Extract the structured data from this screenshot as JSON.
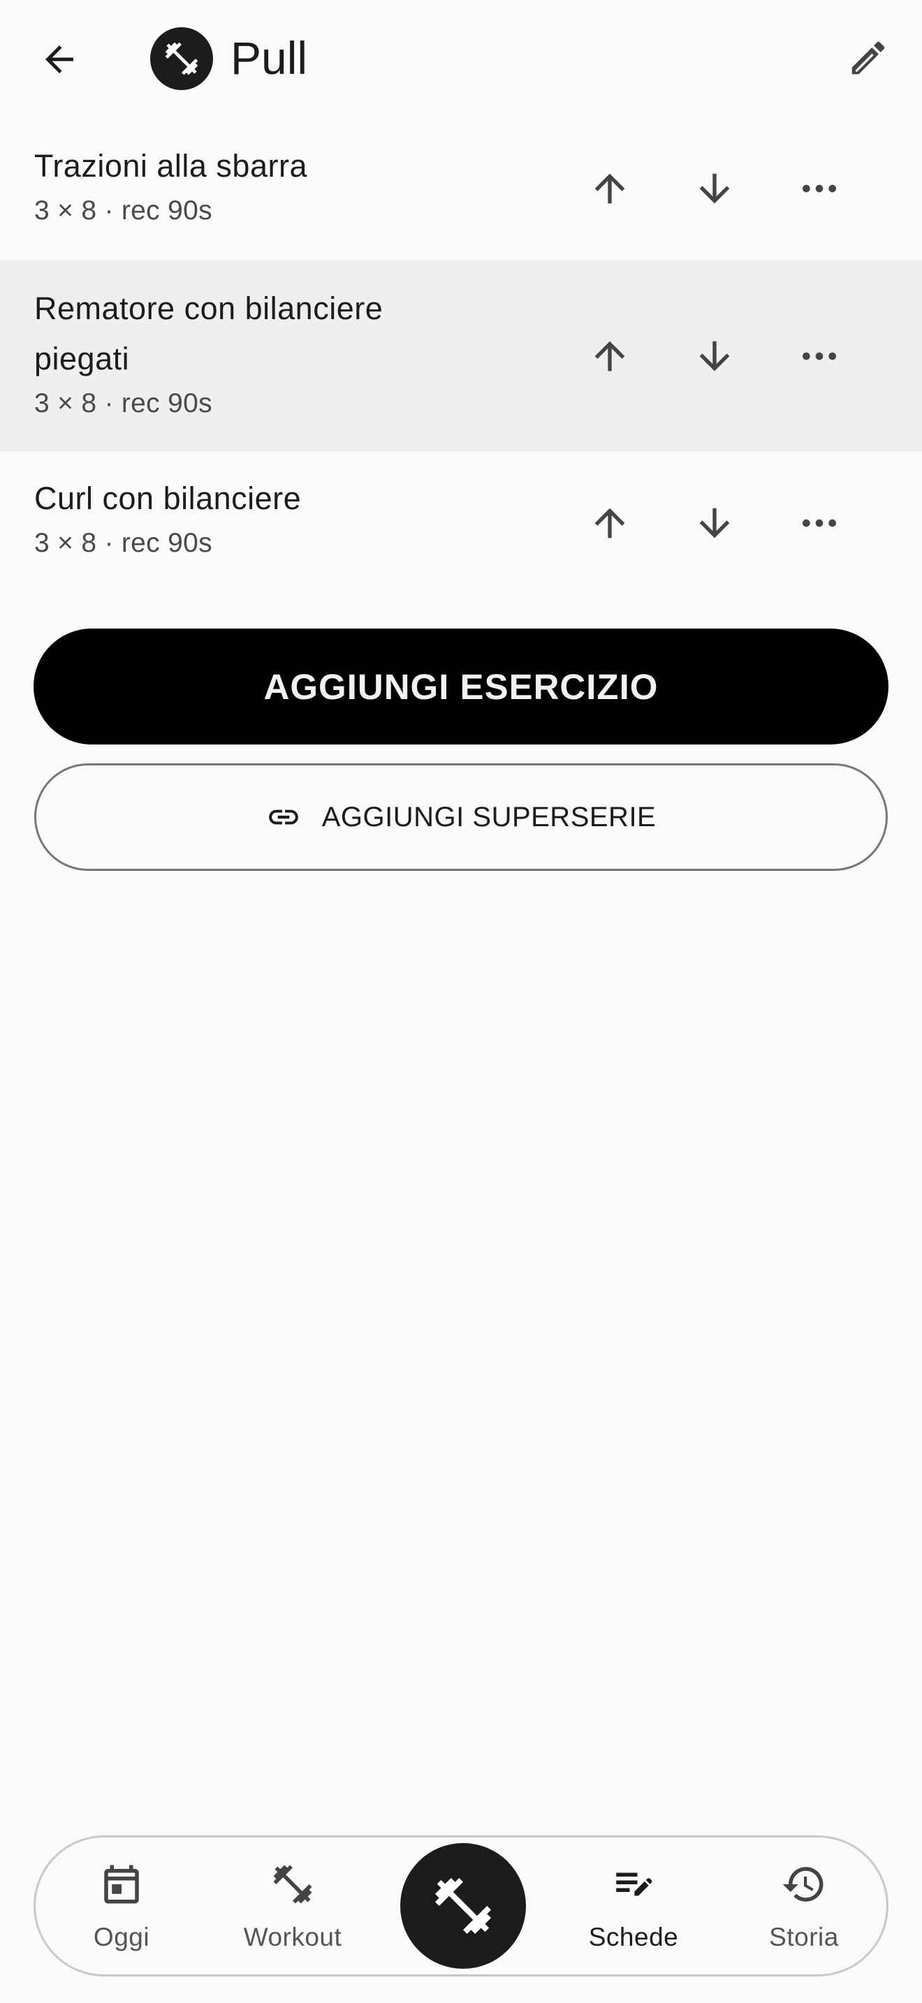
{
  "header": {
    "title": "Pull"
  },
  "exercises": [
    {
      "name": "Trazioni alla sbarra",
      "meta": "3 × 8 · rec 90s"
    },
    {
      "name": "Rematore con bilanciere piegati",
      "meta": "3 × 8 · rec 90s"
    },
    {
      "name": "Curl con bilanciere",
      "meta": "3 × 8 · rec 90s"
    }
  ],
  "actions": {
    "add_exercise_label": "AGGIUNGI ESERCIZIO",
    "add_superset_label": "AGGIUNGI SUPERSERIE"
  },
  "nav": {
    "items": [
      {
        "label": "Oggi",
        "icon": "calendar-icon"
      },
      {
        "label": "Workout",
        "icon": "dumbbell-icon"
      },
      {
        "label": "Schede",
        "icon": "edit-list-icon",
        "active": true
      },
      {
        "label": "Storia",
        "icon": "history-icon"
      }
    ],
    "center_icon": "dumbbell-icon"
  },
  "colors": {
    "background": "#fafafa",
    "primary": "#000000",
    "highlight_row": "#efefef",
    "text_primary": "#1c1c1c",
    "text_secondary": "#4a4a4a"
  }
}
